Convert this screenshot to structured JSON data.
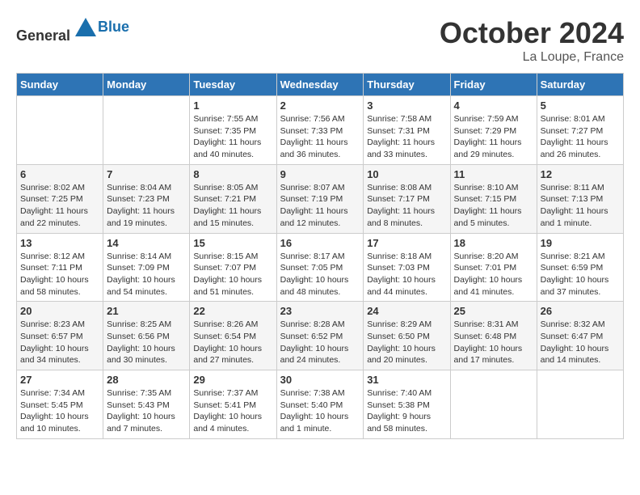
{
  "header": {
    "logo_general": "General",
    "logo_blue": "Blue",
    "month_year": "October 2024",
    "location": "La Loupe, France"
  },
  "calendar": {
    "days_of_week": [
      "Sunday",
      "Monday",
      "Tuesday",
      "Wednesday",
      "Thursday",
      "Friday",
      "Saturday"
    ],
    "weeks": [
      [
        {
          "day": "",
          "sunrise": "",
          "sunset": "",
          "daylight": ""
        },
        {
          "day": "",
          "sunrise": "",
          "sunset": "",
          "daylight": ""
        },
        {
          "day": "1",
          "sunrise": "Sunrise: 7:55 AM",
          "sunset": "Sunset: 7:35 PM",
          "daylight": "Daylight: 11 hours and 40 minutes."
        },
        {
          "day": "2",
          "sunrise": "Sunrise: 7:56 AM",
          "sunset": "Sunset: 7:33 PM",
          "daylight": "Daylight: 11 hours and 36 minutes."
        },
        {
          "day": "3",
          "sunrise": "Sunrise: 7:58 AM",
          "sunset": "Sunset: 7:31 PM",
          "daylight": "Daylight: 11 hours and 33 minutes."
        },
        {
          "day": "4",
          "sunrise": "Sunrise: 7:59 AM",
          "sunset": "Sunset: 7:29 PM",
          "daylight": "Daylight: 11 hours and 29 minutes."
        },
        {
          "day": "5",
          "sunrise": "Sunrise: 8:01 AM",
          "sunset": "Sunset: 7:27 PM",
          "daylight": "Daylight: 11 hours and 26 minutes."
        }
      ],
      [
        {
          "day": "6",
          "sunrise": "Sunrise: 8:02 AM",
          "sunset": "Sunset: 7:25 PM",
          "daylight": "Daylight: 11 hours and 22 minutes."
        },
        {
          "day": "7",
          "sunrise": "Sunrise: 8:04 AM",
          "sunset": "Sunset: 7:23 PM",
          "daylight": "Daylight: 11 hours and 19 minutes."
        },
        {
          "day": "8",
          "sunrise": "Sunrise: 8:05 AM",
          "sunset": "Sunset: 7:21 PM",
          "daylight": "Daylight: 11 hours and 15 minutes."
        },
        {
          "day": "9",
          "sunrise": "Sunrise: 8:07 AM",
          "sunset": "Sunset: 7:19 PM",
          "daylight": "Daylight: 11 hours and 12 minutes."
        },
        {
          "day": "10",
          "sunrise": "Sunrise: 8:08 AM",
          "sunset": "Sunset: 7:17 PM",
          "daylight": "Daylight: 11 hours and 8 minutes."
        },
        {
          "day": "11",
          "sunrise": "Sunrise: 8:10 AM",
          "sunset": "Sunset: 7:15 PM",
          "daylight": "Daylight: 11 hours and 5 minutes."
        },
        {
          "day": "12",
          "sunrise": "Sunrise: 8:11 AM",
          "sunset": "Sunset: 7:13 PM",
          "daylight": "Daylight: 11 hours and 1 minute."
        }
      ],
      [
        {
          "day": "13",
          "sunrise": "Sunrise: 8:12 AM",
          "sunset": "Sunset: 7:11 PM",
          "daylight": "Daylight: 10 hours and 58 minutes."
        },
        {
          "day": "14",
          "sunrise": "Sunrise: 8:14 AM",
          "sunset": "Sunset: 7:09 PM",
          "daylight": "Daylight: 10 hours and 54 minutes."
        },
        {
          "day": "15",
          "sunrise": "Sunrise: 8:15 AM",
          "sunset": "Sunset: 7:07 PM",
          "daylight": "Daylight: 10 hours and 51 minutes."
        },
        {
          "day": "16",
          "sunrise": "Sunrise: 8:17 AM",
          "sunset": "Sunset: 7:05 PM",
          "daylight": "Daylight: 10 hours and 48 minutes."
        },
        {
          "day": "17",
          "sunrise": "Sunrise: 8:18 AM",
          "sunset": "Sunset: 7:03 PM",
          "daylight": "Daylight: 10 hours and 44 minutes."
        },
        {
          "day": "18",
          "sunrise": "Sunrise: 8:20 AM",
          "sunset": "Sunset: 7:01 PM",
          "daylight": "Daylight: 10 hours and 41 minutes."
        },
        {
          "day": "19",
          "sunrise": "Sunrise: 8:21 AM",
          "sunset": "Sunset: 6:59 PM",
          "daylight": "Daylight: 10 hours and 37 minutes."
        }
      ],
      [
        {
          "day": "20",
          "sunrise": "Sunrise: 8:23 AM",
          "sunset": "Sunset: 6:57 PM",
          "daylight": "Daylight: 10 hours and 34 minutes."
        },
        {
          "day": "21",
          "sunrise": "Sunrise: 8:25 AM",
          "sunset": "Sunset: 6:56 PM",
          "daylight": "Daylight: 10 hours and 30 minutes."
        },
        {
          "day": "22",
          "sunrise": "Sunrise: 8:26 AM",
          "sunset": "Sunset: 6:54 PM",
          "daylight": "Daylight: 10 hours and 27 minutes."
        },
        {
          "day": "23",
          "sunrise": "Sunrise: 8:28 AM",
          "sunset": "Sunset: 6:52 PM",
          "daylight": "Daylight: 10 hours and 24 minutes."
        },
        {
          "day": "24",
          "sunrise": "Sunrise: 8:29 AM",
          "sunset": "Sunset: 6:50 PM",
          "daylight": "Daylight: 10 hours and 20 minutes."
        },
        {
          "day": "25",
          "sunrise": "Sunrise: 8:31 AM",
          "sunset": "Sunset: 6:48 PM",
          "daylight": "Daylight: 10 hours and 17 minutes."
        },
        {
          "day": "26",
          "sunrise": "Sunrise: 8:32 AM",
          "sunset": "Sunset: 6:47 PM",
          "daylight": "Daylight: 10 hours and 14 minutes."
        }
      ],
      [
        {
          "day": "27",
          "sunrise": "Sunrise: 7:34 AM",
          "sunset": "Sunset: 5:45 PM",
          "daylight": "Daylight: 10 hours and 10 minutes."
        },
        {
          "day": "28",
          "sunrise": "Sunrise: 7:35 AM",
          "sunset": "Sunset: 5:43 PM",
          "daylight": "Daylight: 10 hours and 7 minutes."
        },
        {
          "day": "29",
          "sunrise": "Sunrise: 7:37 AM",
          "sunset": "Sunset: 5:41 PM",
          "daylight": "Daylight: 10 hours and 4 minutes."
        },
        {
          "day": "30",
          "sunrise": "Sunrise: 7:38 AM",
          "sunset": "Sunset: 5:40 PM",
          "daylight": "Daylight: 10 hours and 1 minute."
        },
        {
          "day": "31",
          "sunrise": "Sunrise: 7:40 AM",
          "sunset": "Sunset: 5:38 PM",
          "daylight": "Daylight: 9 hours and 58 minutes."
        },
        {
          "day": "",
          "sunrise": "",
          "sunset": "",
          "daylight": ""
        },
        {
          "day": "",
          "sunrise": "",
          "sunset": "",
          "daylight": ""
        }
      ]
    ]
  }
}
